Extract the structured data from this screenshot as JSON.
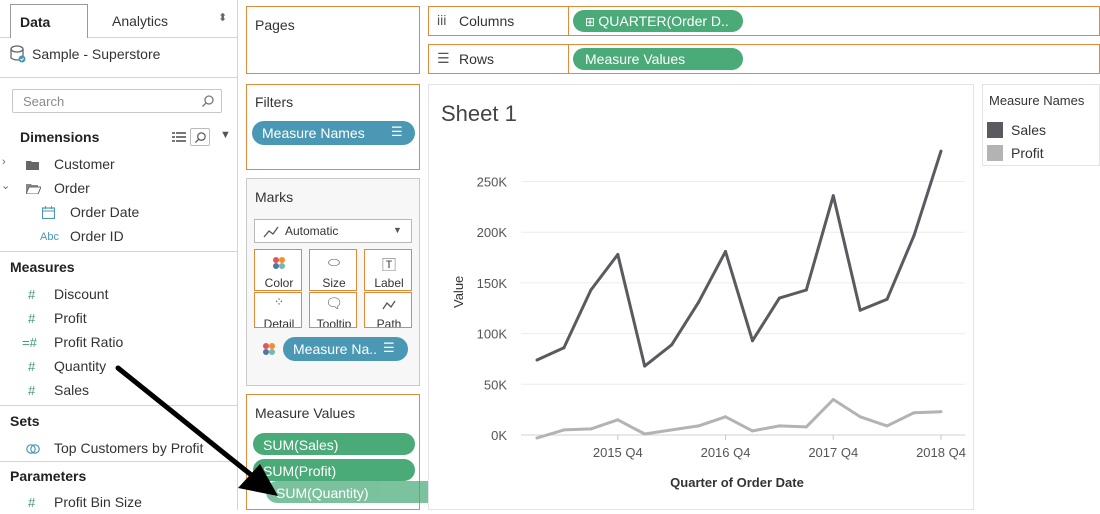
{
  "data_pane": {
    "tab_data": "Data",
    "tab_analytics": "Analytics",
    "datasource": "Sample - Superstore",
    "search_placeholder": "Search",
    "dimensions_header": "Dimensions",
    "dimensions": [
      {
        "label": "Customer",
        "icon": "folder-closed-icon"
      },
      {
        "label": "Order",
        "icon": "folder-open-icon"
      },
      {
        "label": "Order Date",
        "icon": "calendar-icon"
      },
      {
        "label": "Order ID",
        "icon": "abc-icon",
        "prefix": "Abc"
      }
    ],
    "measures_header": "Measures",
    "measures": [
      "Discount",
      "Profit",
      "Profit Ratio",
      "Quantity",
      "Sales"
    ],
    "sets_header": "Sets",
    "sets": [
      "Top Customers by Profit"
    ],
    "parameters_header": "Parameters",
    "parameters": [
      "Profit Bin Size"
    ]
  },
  "pages_card": {
    "title": "Pages"
  },
  "filters_card": {
    "title": "Filters",
    "pill": "Measure Names"
  },
  "marks_card": {
    "title": "Marks",
    "mark_type": "Automatic",
    "buttons": [
      "Color",
      "Size",
      "Label",
      "Detail",
      "Tooltip",
      "Path"
    ],
    "color_pill": "Measure Na.."
  },
  "measure_values_card": {
    "title": "Measure Values",
    "pills": [
      "SUM(Sales)",
      "SUM(Profit)"
    ],
    "dragging_pill": "SUM(Quantity)"
  },
  "columns_shelf": {
    "label": "Columns",
    "pill": "QUARTER(Order D.."
  },
  "rows_shelf": {
    "label": "Rows",
    "pill": "Measure Values"
  },
  "legend": {
    "title": "Measure Names",
    "items": [
      {
        "label": "Sales",
        "color": "#5b5a60"
      },
      {
        "label": "Profit",
        "color": "#b3b3b3"
      }
    ]
  },
  "chart_data": {
    "type": "line",
    "title": "Sheet 1",
    "xlabel": "Quarter of Order Date",
    "ylabel": "Value",
    "categories": [
      "2015 Q1",
      "2015 Q2",
      "2015 Q3",
      "2015 Q4",
      "2016 Q1",
      "2016 Q2",
      "2016 Q3",
      "2016 Q4",
      "2017 Q1",
      "2017 Q2",
      "2017 Q3",
      "2017 Q4",
      "2018 Q1",
      "2018 Q2",
      "2018 Q3",
      "2018 Q4"
    ],
    "x_tick_labels": [
      "2015 Q4",
      "2016 Q4",
      "2017 Q4",
      "2018 Q4"
    ],
    "y_tick_labels": [
      "0K",
      "50K",
      "100K",
      "150K",
      "200K",
      "250K"
    ],
    "ylim": [
      0,
      290000
    ],
    "series": [
      {
        "name": "Sales",
        "color": "#5b5a60",
        "values": [
          74000,
          86000,
          143000,
          178000,
          68000,
          89000,
          131000,
          181000,
          93000,
          135000,
          143000,
          236000,
          123000,
          134000,
          197000,
          280000
        ]
      },
      {
        "name": "Profit",
        "color": "#b3b3b3",
        "values": [
          -3000,
          5000,
          6000,
          15000,
          1000,
          5000,
          9000,
          18000,
          4000,
          9000,
          8000,
          35000,
          18000,
          9000,
          22000,
          23000
        ]
      }
    ],
    "grid": "horizontal",
    "legend_position": "right"
  }
}
